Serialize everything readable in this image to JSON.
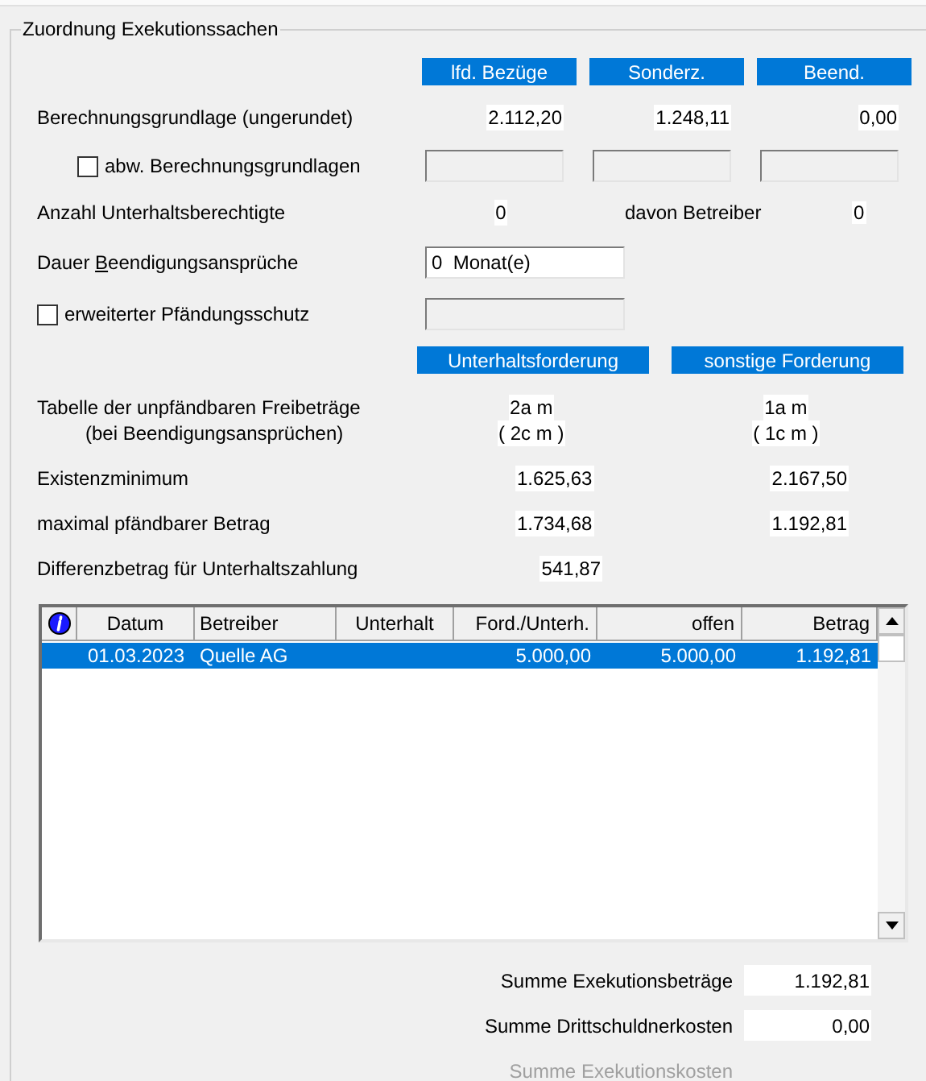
{
  "group_title": "Zuordnung Exekutionssachen",
  "column_headers": [
    "lfd. Bezüge",
    "Sonderz.",
    "Beend."
  ],
  "basis": {
    "label": "Berechnungsgrundlage (ungerundet)",
    "values": [
      "2.112,20",
      "1.248,11",
      "0,00"
    ]
  },
  "alt_basis": {
    "label": "abw. Berechnungsgrundlagen",
    "checked": false,
    "fields": [
      {
        "disabled": true
      },
      {
        "disabled": true
      },
      {
        "disabled": true
      }
    ]
  },
  "dependents": {
    "label": "Anzahl Unterhaltsberechtigte",
    "value": "0",
    "sub_label": "davon Betreiber",
    "sub_value": "0"
  },
  "duration": {
    "label_prefix": "Dauer ",
    "label_access_key": "B",
    "label_rest": "eendigungsansprüche",
    "value": "0  Monat(e)"
  },
  "extended": {
    "label": "erweiterter Pfändungsschutz",
    "checked": false,
    "field_disabled": true
  },
  "claim_headers": [
    "Unterhaltsforderung",
    "sonstige Forderung"
  ],
  "table_lookup": {
    "label_lines": [
      "Tabelle der unpfändbaren Freibeträge",
      "(bei Beendigungsansprüchen)"
    ],
    "values": [
      [
        "2a m",
        "( 2c m )"
      ],
      [
        "1a m",
        "( 1c m )"
      ]
    ]
  },
  "amounts": [
    {
      "label": "Existenzminimum",
      "values": [
        "1.625,63",
        "2.167,50"
      ]
    },
    {
      "label": "maximal pfändbarer Betrag",
      "values": [
        "1.734,68",
        "1.192,81"
      ]
    },
    {
      "label": "Differenzbetrag für Unterhaltszahlung",
      "values": [
        "541,87"
      ]
    }
  ],
  "table": {
    "columns": [
      "Datum",
      "Betreiber",
      "Unterhalt",
      "Ford./Unterh.",
      "offen",
      "Betrag"
    ],
    "rows": [
      {
        "cells": [
          "01.03.2023",
          "Quelle AG",
          null,
          "5.000,00",
          "5.000,00",
          "1.192,81"
        ],
        "selected": true
      }
    ]
  },
  "totals": [
    {
      "label": "Summe Exekutionsbeträge",
      "value": "1.192,81",
      "disabled": false
    },
    {
      "label": "Summe Drittschuldnerkosten",
      "value": "0,00",
      "disabled": false
    },
    {
      "label": "Summe Exekutionskosten",
      "disabled": true
    }
  ]
}
